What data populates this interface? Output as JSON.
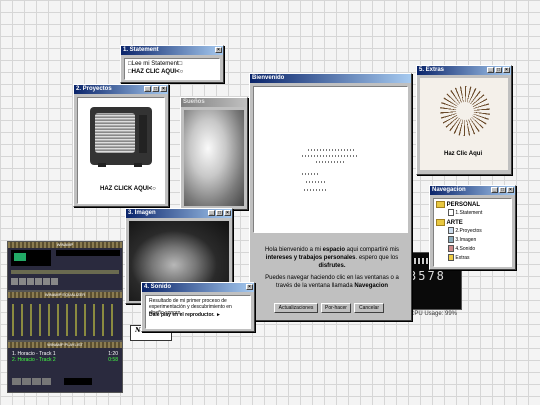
{
  "statement": {
    "title": "1. Statement",
    "line1": "□Lee mi Statement□",
    "line2": "□HAZ CLIC AQUI<○"
  },
  "proyectos": {
    "title": "2. Proyectos",
    "caption": "HAZ CLICK AQUI<○"
  },
  "sueños": {
    "title": "Sueños"
  },
  "bienvenido": {
    "title": "Bienvenido",
    "text_plain_1": "Hola bienvenido a mi ",
    "text_bold_1": "espacio",
    "text_plain_2": " aqui compartiré mis ",
    "text_bold_2": "intereses y trabajos personales",
    "text_plain_3": ". espero que los ",
    "text_bold_3": "disfrutes.",
    "text2_plain": "Puedes navegar haciendo clic en las ventanas o a través de la ventana llamada ",
    "text2_bold": "Navegacion",
    "btn_actualizaciones": "Actualizaciones",
    "btn_porhacer": "Por-hacer",
    "btn_cancelar": "Cancelar"
  },
  "extras": {
    "title": "5. Extras",
    "caption": "Haz Clic Aqui"
  },
  "navegacion": {
    "title": "Navegacion",
    "items": [
      {
        "label": "PERSONAL",
        "level": 0,
        "folder": true
      },
      {
        "label": "1.Statement",
        "level": 1,
        "folder": false
      },
      {
        "label": "ARTE",
        "level": 0,
        "folder": true
      },
      {
        "label": "2.Proyectos",
        "level": 1,
        "folder": false
      },
      {
        "label": "3.Imagen",
        "level": 1,
        "folder": false
      },
      {
        "label": "4.Sonido",
        "level": 1,
        "folder": false
      },
      {
        "label": "Extras",
        "level": 1,
        "folder": false
      }
    ]
  },
  "imagen": {
    "title": "3. Imagen"
  },
  "sonido": {
    "title": "4. Sonido",
    "text": "Resultado de mi primer proceso de experimentación y descubrimiento en diseño sonoro.",
    "play_text": "Dale play en el reproductor. ►"
  },
  "cpu": {
    "numbers": "3578",
    "label": "CPU Usage: 99%"
  },
  "winamp": {
    "title": "WINAMP",
    "eq_title": "WINAMP EQUALIZER",
    "pl_title": "WINAMP PLAYLIST",
    "tracks": [
      {
        "name": "1. Horacio - Track 1",
        "time": "1:20"
      },
      {
        "name": "2. Horacio - Track 2",
        "time": "0:58"
      }
    ]
  },
  "desktop_icon": {
    "label": "Nocturno"
  }
}
